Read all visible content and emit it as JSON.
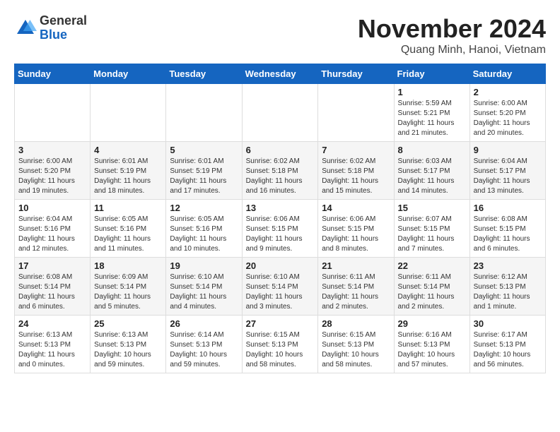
{
  "header": {
    "logo_general": "General",
    "logo_blue": "Blue",
    "month_title": "November 2024",
    "location": "Quang Minh, Hanoi, Vietnam"
  },
  "calendar": {
    "weekdays": [
      "Sunday",
      "Monday",
      "Tuesday",
      "Wednesday",
      "Thursday",
      "Friday",
      "Saturday"
    ],
    "weeks": [
      [
        {
          "day": "",
          "sunrise": "",
          "sunset": "",
          "daylight": ""
        },
        {
          "day": "",
          "sunrise": "",
          "sunset": "",
          "daylight": ""
        },
        {
          "day": "",
          "sunrise": "",
          "sunset": "",
          "daylight": ""
        },
        {
          "day": "",
          "sunrise": "",
          "sunset": "",
          "daylight": ""
        },
        {
          "day": "",
          "sunrise": "",
          "sunset": "",
          "daylight": ""
        },
        {
          "day": "1",
          "sunrise": "Sunrise: 5:59 AM",
          "sunset": "Sunset: 5:21 PM",
          "daylight": "Daylight: 11 hours and 21 minutes."
        },
        {
          "day": "2",
          "sunrise": "Sunrise: 6:00 AM",
          "sunset": "Sunset: 5:20 PM",
          "daylight": "Daylight: 11 hours and 20 minutes."
        }
      ],
      [
        {
          "day": "3",
          "sunrise": "Sunrise: 6:00 AM",
          "sunset": "Sunset: 5:20 PM",
          "daylight": "Daylight: 11 hours and 19 minutes."
        },
        {
          "day": "4",
          "sunrise": "Sunrise: 6:01 AM",
          "sunset": "Sunset: 5:19 PM",
          "daylight": "Daylight: 11 hours and 18 minutes."
        },
        {
          "day": "5",
          "sunrise": "Sunrise: 6:01 AM",
          "sunset": "Sunset: 5:19 PM",
          "daylight": "Daylight: 11 hours and 17 minutes."
        },
        {
          "day": "6",
          "sunrise": "Sunrise: 6:02 AM",
          "sunset": "Sunset: 5:18 PM",
          "daylight": "Daylight: 11 hours and 16 minutes."
        },
        {
          "day": "7",
          "sunrise": "Sunrise: 6:02 AM",
          "sunset": "Sunset: 5:18 PM",
          "daylight": "Daylight: 11 hours and 15 minutes."
        },
        {
          "day": "8",
          "sunrise": "Sunrise: 6:03 AM",
          "sunset": "Sunset: 5:17 PM",
          "daylight": "Daylight: 11 hours and 14 minutes."
        },
        {
          "day": "9",
          "sunrise": "Sunrise: 6:04 AM",
          "sunset": "Sunset: 5:17 PM",
          "daylight": "Daylight: 11 hours and 13 minutes."
        }
      ],
      [
        {
          "day": "10",
          "sunrise": "Sunrise: 6:04 AM",
          "sunset": "Sunset: 5:16 PM",
          "daylight": "Daylight: 11 hours and 12 minutes."
        },
        {
          "day": "11",
          "sunrise": "Sunrise: 6:05 AM",
          "sunset": "Sunset: 5:16 PM",
          "daylight": "Daylight: 11 hours and 11 minutes."
        },
        {
          "day": "12",
          "sunrise": "Sunrise: 6:05 AM",
          "sunset": "Sunset: 5:16 PM",
          "daylight": "Daylight: 11 hours and 10 minutes."
        },
        {
          "day": "13",
          "sunrise": "Sunrise: 6:06 AM",
          "sunset": "Sunset: 5:15 PM",
          "daylight": "Daylight: 11 hours and 9 minutes."
        },
        {
          "day": "14",
          "sunrise": "Sunrise: 6:06 AM",
          "sunset": "Sunset: 5:15 PM",
          "daylight": "Daylight: 11 hours and 8 minutes."
        },
        {
          "day": "15",
          "sunrise": "Sunrise: 6:07 AM",
          "sunset": "Sunset: 5:15 PM",
          "daylight": "Daylight: 11 hours and 7 minutes."
        },
        {
          "day": "16",
          "sunrise": "Sunrise: 6:08 AM",
          "sunset": "Sunset: 5:15 PM",
          "daylight": "Daylight: 11 hours and 6 minutes."
        }
      ],
      [
        {
          "day": "17",
          "sunrise": "Sunrise: 6:08 AM",
          "sunset": "Sunset: 5:14 PM",
          "daylight": "Daylight: 11 hours and 6 minutes."
        },
        {
          "day": "18",
          "sunrise": "Sunrise: 6:09 AM",
          "sunset": "Sunset: 5:14 PM",
          "daylight": "Daylight: 11 hours and 5 minutes."
        },
        {
          "day": "19",
          "sunrise": "Sunrise: 6:10 AM",
          "sunset": "Sunset: 5:14 PM",
          "daylight": "Daylight: 11 hours and 4 minutes."
        },
        {
          "day": "20",
          "sunrise": "Sunrise: 6:10 AM",
          "sunset": "Sunset: 5:14 PM",
          "daylight": "Daylight: 11 hours and 3 minutes."
        },
        {
          "day": "21",
          "sunrise": "Sunrise: 6:11 AM",
          "sunset": "Sunset: 5:14 PM",
          "daylight": "Daylight: 11 hours and 2 minutes."
        },
        {
          "day": "22",
          "sunrise": "Sunrise: 6:11 AM",
          "sunset": "Sunset: 5:14 PM",
          "daylight": "Daylight: 11 hours and 2 minutes."
        },
        {
          "day": "23",
          "sunrise": "Sunrise: 6:12 AM",
          "sunset": "Sunset: 5:13 PM",
          "daylight": "Daylight: 11 hours and 1 minute."
        }
      ],
      [
        {
          "day": "24",
          "sunrise": "Sunrise: 6:13 AM",
          "sunset": "Sunset: 5:13 PM",
          "daylight": "Daylight: 11 hours and 0 minutes."
        },
        {
          "day": "25",
          "sunrise": "Sunrise: 6:13 AM",
          "sunset": "Sunset: 5:13 PM",
          "daylight": "Daylight: 10 hours and 59 minutes."
        },
        {
          "day": "26",
          "sunrise": "Sunrise: 6:14 AM",
          "sunset": "Sunset: 5:13 PM",
          "daylight": "Daylight: 10 hours and 59 minutes."
        },
        {
          "day": "27",
          "sunrise": "Sunrise: 6:15 AM",
          "sunset": "Sunset: 5:13 PM",
          "daylight": "Daylight: 10 hours and 58 minutes."
        },
        {
          "day": "28",
          "sunrise": "Sunrise: 6:15 AM",
          "sunset": "Sunset: 5:13 PM",
          "daylight": "Daylight: 10 hours and 58 minutes."
        },
        {
          "day": "29",
          "sunrise": "Sunrise: 6:16 AM",
          "sunset": "Sunset: 5:13 PM",
          "daylight": "Daylight: 10 hours and 57 minutes."
        },
        {
          "day": "30",
          "sunrise": "Sunrise: 6:17 AM",
          "sunset": "Sunset: 5:13 PM",
          "daylight": "Daylight: 10 hours and 56 minutes."
        }
      ]
    ]
  }
}
